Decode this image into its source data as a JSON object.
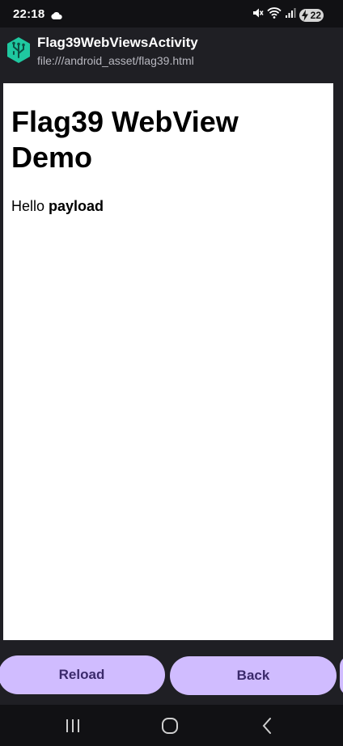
{
  "status_bar": {
    "time": "22:18",
    "battery_level": "22",
    "icons": [
      "cloud-icon",
      "mute-icon",
      "wifi-icon",
      "signal-icon",
      "battery-icon"
    ]
  },
  "app_bar": {
    "title": "Flag39WebViewsActivity",
    "subtitle": "file:///android_asset/flag39.html",
    "icon": "app-logo-icon"
  },
  "webview": {
    "heading": "Flag39 WebView Demo",
    "paragraph_prefix": "Hello ",
    "paragraph_bold": "payload"
  },
  "buttons": {
    "reload_label": "Reload",
    "back_label": "Back"
  },
  "nav_bar": {
    "icons": [
      "recent-apps-icon",
      "home-icon",
      "back-icon"
    ]
  },
  "colors": {
    "background": "#1f1f24",
    "system_bar": "#111114",
    "button_fill": "#d0bcff",
    "button_text": "#3b2a6b",
    "logo_accent": "#1fc8a0"
  }
}
